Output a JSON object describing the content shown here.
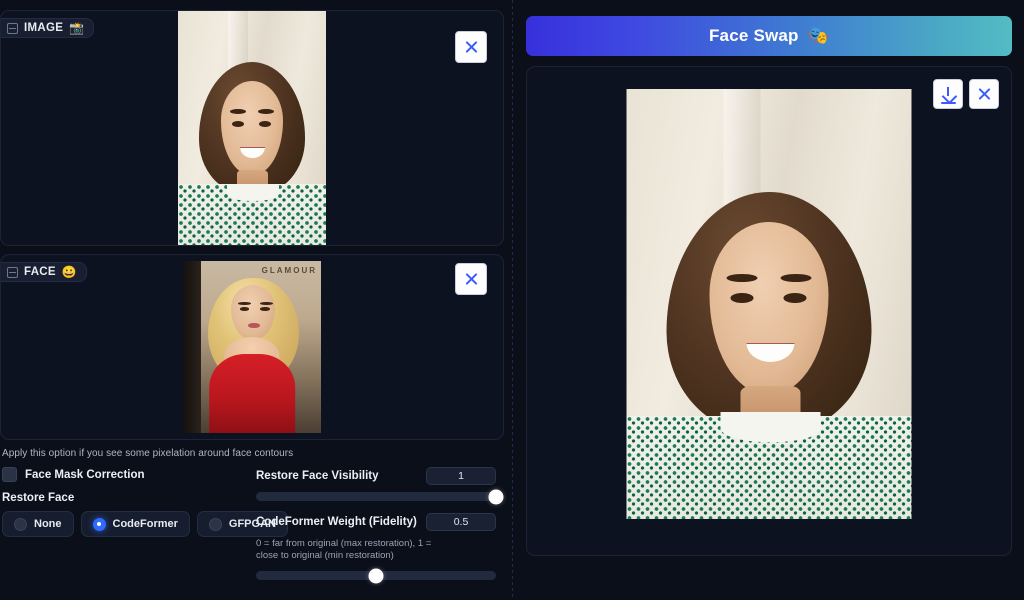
{
  "left": {
    "image_zone": {
      "badge_label": "IMAGE",
      "badge_emoji": "📸",
      "badge_icon": "image-placeholder-icon",
      "close_icon": "close-icon"
    },
    "face_zone": {
      "badge_label": "FACE",
      "badge_emoji": "😀",
      "badge_icon": "image-placeholder-icon",
      "close_icon": "close-icon"
    }
  },
  "controls": {
    "hint": "Apply this option if you see some pixelation around face contours",
    "face_mask_correction": {
      "label": "Face Mask Correction",
      "checked": false
    },
    "restore_face": {
      "label": "Restore Face",
      "options": [
        {
          "label": "None",
          "selected": false
        },
        {
          "label": "CodeFormer",
          "selected": true
        },
        {
          "label": "GFPGAN",
          "selected": false
        }
      ]
    },
    "restore_face_visibility": {
      "label": "Restore Face Visibility",
      "value": "1",
      "percent": 100
    },
    "codeformer_weight": {
      "label": "CodeFormer Weight (Fidelity)",
      "value": "0.5",
      "percent": 50,
      "description": "0 = far from original (max restoration), 1 = close to original (min restoration)"
    }
  },
  "result": {
    "header_title": "Face Swap",
    "header_emoji": "🎭",
    "download_icon": "download-icon",
    "close_icon": "close-icon"
  },
  "photos": {
    "source_banner": "GLAMOUR"
  },
  "colors": {
    "background": "#0b0f19",
    "panel": "#0d1220",
    "accent_blue": "#3b5bfd",
    "radio_selected": "#2f6bff",
    "gradient_start": "#3730dd",
    "gradient_end": "#52bcc4"
  }
}
